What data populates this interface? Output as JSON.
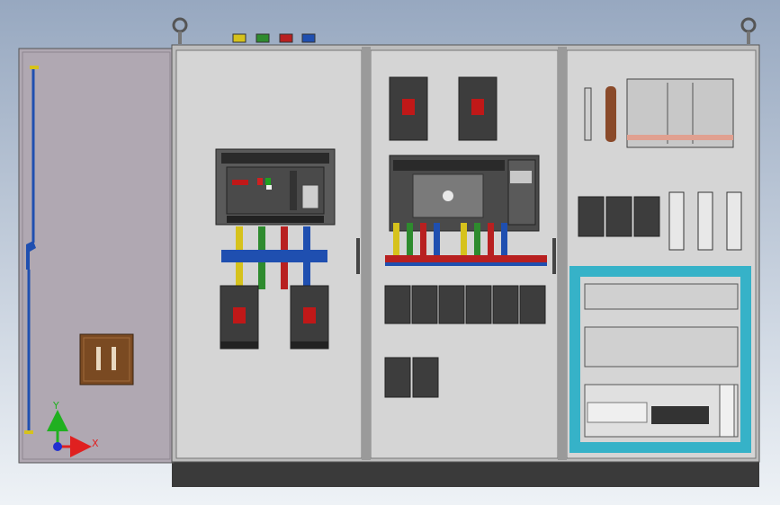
{
  "view": {
    "background_top": "#97a8c0",
    "background_bottom": "#eef2f6",
    "colors": {
      "panel": "#d5d5d5",
      "frame": "#9a9a9a",
      "plinth": "#3a3a3a",
      "door": "#b0a8b2",
      "busbar_yellow": "#d6c21c",
      "busbar_green": "#2e8b2e",
      "busbar_red": "#b82020",
      "busbar_blue": "#1f4fb0",
      "cable_tray": "#36b2c8",
      "breaker": "#3d3d3d",
      "handle": "#c01818",
      "copper_bar": "#8a4a2a",
      "socket": "#7a4a22"
    }
  },
  "triad": {
    "x_label": "X",
    "y_label": "Y",
    "x_color": "#e02020",
    "y_color": "#20b020",
    "z_color": "#2030d0"
  },
  "sections": [
    {
      "id": "door",
      "name": "open-door",
      "content": [
        "vertical-rod",
        "rod-handle",
        "socket-outlet"
      ]
    },
    {
      "id": "left",
      "name": "incoming-section",
      "content": [
        "air-circuit-breaker",
        "vertical-busbars",
        "horizontal-busbar",
        "outgoing-breaker-a",
        "outgoing-breaker-b"
      ]
    },
    {
      "id": "middle",
      "name": "distribution-section",
      "content": [
        "mccb-top-a",
        "mccb-top-b",
        "drive-unit",
        "busbar-comb",
        "mcb-row",
        "mcb-lower-pair"
      ]
    },
    {
      "id": "right",
      "name": "control-section",
      "content": [
        "terminal-strip",
        "copper-bar",
        "switch-assembly",
        "mcb-group",
        "fuse-holders",
        "cable-trays",
        "relay-row",
        "plc-unit",
        "terminal-block",
        "power-supply"
      ]
    }
  ]
}
